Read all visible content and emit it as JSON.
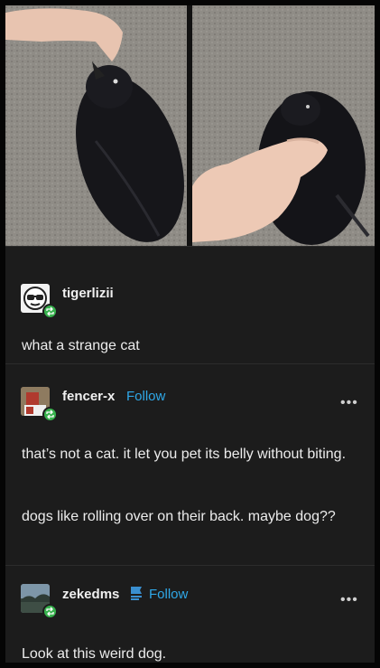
{
  "posts": [
    {
      "username": "tigerlizii",
      "paragraphs": [
        "what a strange cat"
      ]
    },
    {
      "username": "fencer-x",
      "follow_label": "Follow",
      "more_label": "•••",
      "paragraphs": [
        "that’s not a cat. it let you pet its belly without biting.",
        "dogs like rolling over on their back. maybe dog??"
      ]
    },
    {
      "username": "zekedms",
      "follow_label": "Follow",
      "more_label": "•••",
      "paragraphs": [
        "Look at this weird dog."
      ]
    }
  ],
  "colors": {
    "background": "#1c1c1c",
    "follow": "#2fa8e8",
    "reblog_badge": "#37b24d"
  },
  "icons": [
    "sunglasses-avatar-icon",
    "reblog-icon",
    "more-options-icon",
    "flag-icon"
  ]
}
